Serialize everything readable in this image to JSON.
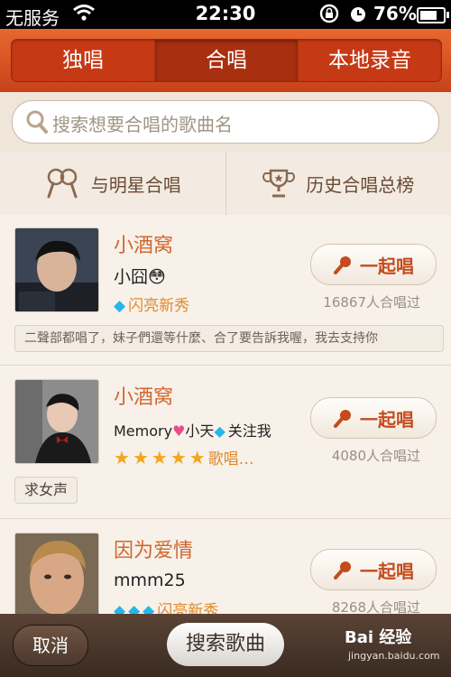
{
  "status": {
    "carrier": "无服务",
    "time": "22:30",
    "battery": "76%",
    "battery_level": 0.76
  },
  "tabs": [
    {
      "label": "独唱",
      "active": false
    },
    {
      "label": "合唱",
      "active": true
    },
    {
      "label": "本地录音",
      "active": false
    }
  ],
  "search": {
    "placeholder": "搜索想要合唱的歌曲名"
  },
  "quick": {
    "star_duet": "与明星合唱",
    "history_rank": "历史合唱总榜"
  },
  "rows": [
    {
      "song": "小酒窝",
      "user": "小囧😳",
      "level": "闪亮新秀",
      "button": "一起唱",
      "count": "16867人合唱过",
      "comment": "二聲部都唱了，妹子們還等什麼、合了要告訴我喔，我去支持你"
    },
    {
      "song": "小酒窝",
      "user_a": "Memory",
      "user_b": "小天",
      "user_c": "关注我",
      "level": "歌唱…",
      "stars": 5,
      "button": "一起唱",
      "count": "4080人合唱过",
      "tag": "求女声"
    },
    {
      "song": "因为爱情",
      "user": "mmm25",
      "level": "闪亮新秀",
      "button": "一起唱",
      "count": "8268人合唱过"
    }
  ],
  "bottom": {
    "cancel": "取消",
    "search_song": "搜索歌曲",
    "brand": "Bai 经验",
    "brand_sub": "jingyan.baidu.com"
  },
  "colors": {
    "accent": "#d2662e",
    "header": "#c8421a",
    "bottombar": "#3a2b22"
  }
}
